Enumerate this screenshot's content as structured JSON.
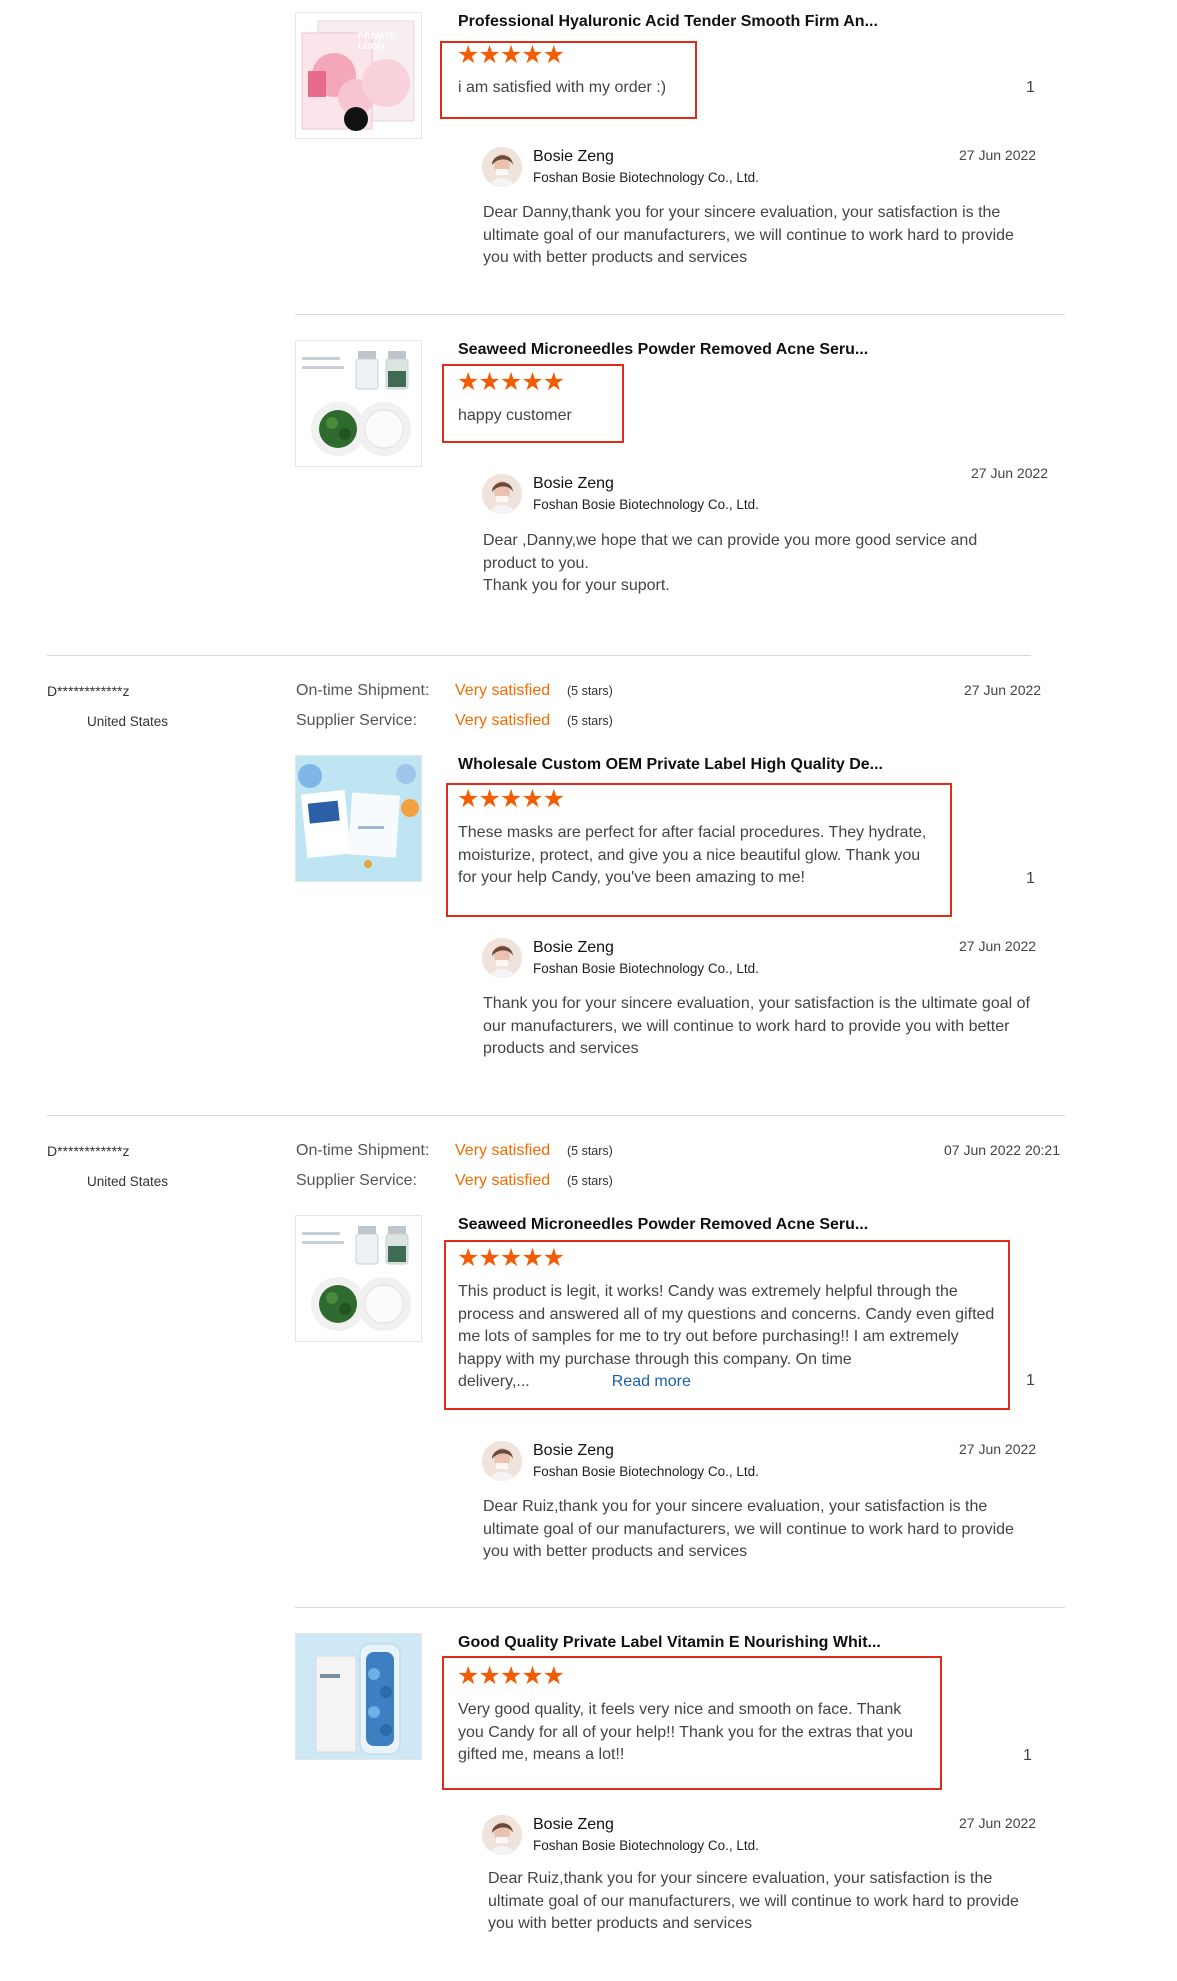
{
  "reviews": [
    {
      "product_title": "Professional Hyaluronic Acid Tender Smooth Firm An...",
      "thumb_label": "PRIVATE LOGO",
      "stars": "★★★★★",
      "text": "i am satisfied with my order :)",
      "count": "1",
      "reply": {
        "name": "Bosie Zeng",
        "company": "Foshan Bosie Biotechnology Co., Ltd.",
        "date": "27 Jun 2022",
        "text": "Dear Danny,thank you for your sincere evaluation, your satisfaction is the ultimate goal of our manufacturers, we will continue to work hard to provide you with better products and services"
      }
    },
    {
      "product_title": "Seaweed Microneedles Powder Removed Acne Seru...",
      "stars": "★★★★★",
      "text": "happy customer",
      "reply": {
        "name": "Bosie Zeng",
        "company": "Foshan Bosie Biotechnology Co., Ltd.",
        "date": "27 Jun 2022",
        "text": "Dear ,Danny,we hope that we can provide you more good service and product to you.\nThank you for your suport."
      }
    }
  ],
  "buyers": [
    {
      "name": "D************z",
      "country": "United States",
      "shipment_label": "On-time Shipment:",
      "shipment_value": "Very satisfied",
      "shipment_stars": "(5 stars)",
      "service_label": "Supplier Service:",
      "service_value": "Very satisfied",
      "service_stars": "(5 stars)",
      "date": "27 Jun 2022",
      "reviews": [
        {
          "product_title": "Wholesale Custom OEM Private Label High Quality De...",
          "stars": "★★★★★",
          "text": "These masks are perfect for after facial procedures. They hydrate, moisturize, protect, and give you a nice beautiful glow. Thank you for your help Candy, you've been amazing to me!",
          "count": "1",
          "reply": {
            "name": "Bosie Zeng",
            "company": "Foshan Bosie Biotechnology Co., Ltd.",
            "date": "27 Jun 2022",
            "text": "Thank you for your sincere evaluation, your satisfaction is the ultimate goal of our manufacturers, we will continue to work hard to provide you with better products and services"
          }
        }
      ]
    },
    {
      "name": "D************z",
      "country": "United States",
      "shipment_label": "On-time Shipment:",
      "shipment_value": "Very satisfied",
      "shipment_stars": "(5 stars)",
      "service_label": "Supplier Service:",
      "service_value": "Very satisfied",
      "service_stars": "(5 stars)",
      "date": "07 Jun 2022 20:21",
      "reviews": [
        {
          "product_title": "Seaweed Microneedles Powder Removed Acne Seru...",
          "stars": "★★★★★",
          "text": "This product is legit, it works! Candy was extremely helpful through the process and answered all of my questions and concerns. Candy even gifted me lots of samples for me to try out before purchasing!! I am extremely happy with my purchase through this company. On time delivery,...",
          "read_more": "Read more",
          "count": "1",
          "reply": {
            "name": "Bosie Zeng",
            "company": "Foshan Bosie Biotechnology Co., Ltd.",
            "date": "27 Jun 2022",
            "text": "Dear Ruiz,thank you for your sincere evaluation, your satisfaction is the ultimate goal of our manufacturers, we will continue to work hard to provide you with better products and services"
          }
        },
        {
          "product_title": "Good Quality Private Label Vitamin E Nourishing Whit...",
          "stars": "★★★★★",
          "text": "Very good quality, it feels very nice and smooth on face. Thank you Candy for all of your help!! Thank you for the extras that you gifted me, means a lot!!",
          "count": "1",
          "reply": {
            "name": "Bosie Zeng",
            "company": "Foshan Bosie Biotechnology Co., Ltd.",
            "date": "27 Jun 2022",
            "text": "Dear Ruiz,thank you for your sincere evaluation, your satisfaction is the ultimate goal of our manufacturers, we will continue to work hard to provide you with better products and services"
          }
        }
      ]
    }
  ],
  "colors": {
    "accent_orange": "#ef6c00",
    "star_orange": "#f25c05",
    "highlight_red": "#e02d1b",
    "link_blue": "#1a5fb4"
  }
}
